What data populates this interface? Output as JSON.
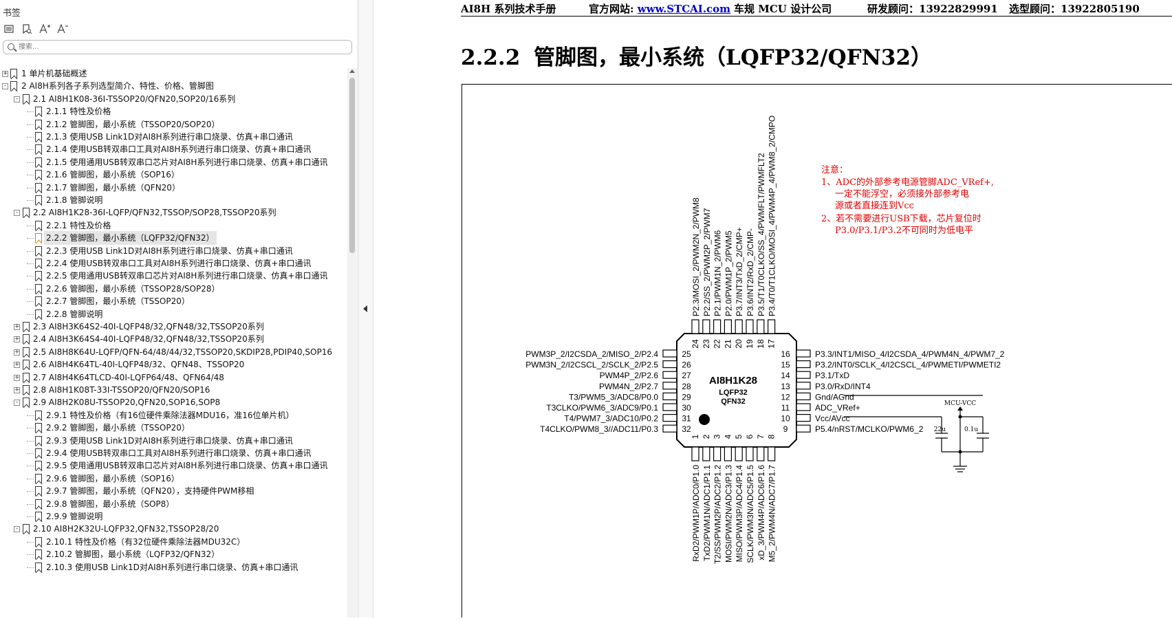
{
  "sidebar": {
    "title": "书签",
    "search_placeholder": "搜索...",
    "tools": [
      "list-icon",
      "bookmark-search-icon",
      "font-increase-icon",
      "font-decrease-icon"
    ],
    "items": [
      {
        "level": 0,
        "expander": "+",
        "label": "1 单片机基础概述"
      },
      {
        "level": 0,
        "expander": "-",
        "label": "2  AI8H系列各子系列选型简介、特性、价格、管脚图"
      },
      {
        "level": 1,
        "expander": "-",
        "label": "2.1 AI8H1K08-36I-TSSOP20/QFN20,SOP20/16系列"
      },
      {
        "level": 2,
        "expander": "",
        "label": "2.1.1 特性及价格"
      },
      {
        "level": 2,
        "expander": "",
        "label": "2.1.2  管脚图，最小系统（TSSOP20/SOP20）"
      },
      {
        "level": 2,
        "expander": "",
        "label": "2.1.3  使用USB Link1D对AI8H系列进行串口烧录、仿真+串口通讯"
      },
      {
        "level": 2,
        "expander": "",
        "label": "2.1.4 使用USB转双串口工具对AI8H系列进行串口烧录、仿真+串口通讯"
      },
      {
        "level": 2,
        "expander": "",
        "label": "2.1.5 使用通用USB转双串口芯片对AI8H系列进行串口烧录、仿真+串口通讯"
      },
      {
        "level": 2,
        "expander": "",
        "label": "2.1.6  管脚图，最小系统（SOP16）"
      },
      {
        "level": 2,
        "expander": "",
        "label": "2.1.7 管脚图，最小系统（QFN20）"
      },
      {
        "level": 2,
        "expander": "",
        "label": "2.1.8  管脚说明"
      },
      {
        "level": 1,
        "expander": "-",
        "label": "2.2  AI8H1K28-36I-LQFP/QFN32,TSSOP/SOP28,TSSOP20系列"
      },
      {
        "level": 2,
        "expander": "",
        "label": "2.2.1 特性及价格"
      },
      {
        "level": 2,
        "expander": "",
        "label": "2.2.2  管脚图，最小系统（LQFP32/QFN32）",
        "selected": true
      },
      {
        "level": 2,
        "expander": "",
        "label": "2.2.3  使用USB Link1D对AI8H系列进行串口烧录、仿真+串口通讯"
      },
      {
        "level": 2,
        "expander": "",
        "label": "2.2.4 使用USB转双串口工具对AI8H系列进行串口烧录、仿真+串口通讯"
      },
      {
        "level": 2,
        "expander": "",
        "label": "2.2.5 使用通用USB转双串口芯片对AI8H系列进行串口烧录、仿真+串口通讯"
      },
      {
        "level": 2,
        "expander": "",
        "label": "2.2.6  管脚图，最小系统（TSSOP28/SOP28）"
      },
      {
        "level": 2,
        "expander": "",
        "label": "2.2.7 管脚图，最小系统（TSSOP20）"
      },
      {
        "level": 2,
        "expander": "",
        "label": "2.2.8  管脚说明"
      },
      {
        "level": 1,
        "expander": "+",
        "label": "2.3  AI8H3K64S2-40I-LQFP48/32,QFN48/32,TSSOP20系列"
      },
      {
        "level": 1,
        "expander": "+",
        "label": "2.4  AI8H3K64S4-40I-LQFP48/32,QFN48/32,TSSOP20系列"
      },
      {
        "level": 1,
        "expander": "+",
        "label": "2.5  AI8H8K64U-LQFP/QFN-64/48/44/32,TSSOP20,SKDIP28,PDIP40,SOP16"
      },
      {
        "level": 1,
        "expander": "+",
        "label": "2.6  AI8H4K64TL-40I-LQFP48/32、QFN48、TSSOP20"
      },
      {
        "level": 1,
        "expander": "+",
        "label": "2.7  AI8H4K64TLCD-40I-LQFP64/48、QFN64/48"
      },
      {
        "level": 1,
        "expander": "+",
        "label": "2.8  AI8H1K08T-33I-TSSOP20/QFN20/SOP16"
      },
      {
        "level": 1,
        "expander": "-",
        "label": "2.9  AI8H2K08U-TSSOP20,QFN20,SOP16,SOP8"
      },
      {
        "level": 2,
        "expander": "",
        "label": "2.9.1 特性及价格（有16位硬件乘除法器MDU16，准16位单片机）"
      },
      {
        "level": 2,
        "expander": "",
        "label": "2.9.2  管脚图，最小系统（TSSOP20）"
      },
      {
        "level": 2,
        "expander": "",
        "label": "2.9.3  使用USB Link1D对AI8H系列进行串口烧录、仿真+串口通讯"
      },
      {
        "level": 2,
        "expander": "",
        "label": "2.9.4 使用USB转双串口工具对AI8H系列进行串口烧录、仿真+串口通讯"
      },
      {
        "level": 2,
        "expander": "",
        "label": "2.9.5 使用通用USB转双串口芯片对AI8H系列进行串口烧录、仿真+串口通讯"
      },
      {
        "level": 2,
        "expander": "",
        "label": "2.9.6  管脚图，最小系统（SOP16）"
      },
      {
        "level": 2,
        "expander": "",
        "label": "2.9.7  管脚图，最小系统（QFN20），支持硬件PWM移相"
      },
      {
        "level": 2,
        "expander": "",
        "label": "2.9.8  管脚图，最小系统（SOP8）"
      },
      {
        "level": 2,
        "expander": "",
        "label": "2.9.9  管脚说明"
      },
      {
        "level": 1,
        "expander": "-",
        "label": "2.10  AI8H2K32U-LQFP32,QFN32,TSSOP28/20"
      },
      {
        "level": 2,
        "expander": "",
        "label": "2.10.1 特性及价格（有32位硬件乘除法器MDU32C）"
      },
      {
        "level": 2,
        "expander": "",
        "label": "2.10.2  管脚图，最小系统（LQFP32/QFN32）"
      },
      {
        "level": 2,
        "expander": "",
        "label": "2.10.3  使用USB Link1D对AI8H系列进行串口烧录、仿真+串口通讯"
      }
    ]
  },
  "page": {
    "header": {
      "manual": "AI8H 系列技术手册",
      "website_label": "官方网站:",
      "website_link": "www.STCAI.com",
      "company": "车规 MCU 设计公司",
      "dev_consultant": "研发顾问：13922829991",
      "selection_consultant": "选型顾问：13922805190"
    },
    "heading_num": "2.2.2",
    "heading_text": "管脚图，最小系统（LQFP32/QFN32）"
  },
  "diagram": {
    "chip_name": "AI8H1K28",
    "package1": "LQFP32",
    "package2": "QFN32",
    "notes": [
      "注意：",
      "1、ADC的外部参考电源管脚ADC_VRef+,",
      "一定不能浮空，必须接外部参考电",
      "源或者直接连到Vcc",
      "2、若不需要进行USB下载，芯片复位时",
      "P3.0/P3.1/P3.2不可同时为低电平"
    ],
    "left_pins": [
      {
        "num": "25",
        "label": "PWM3P_2/I2CSDA_2/MISO_2/P2.4"
      },
      {
        "num": "26",
        "label": "PWM3N_2/I2CSCL_2/SCLK_2/P2.5"
      },
      {
        "num": "27",
        "label": "PWM4P_2/P2.6"
      },
      {
        "num": "28",
        "label": "PWM4N_2/P2.7"
      },
      {
        "num": "29",
        "label": "T3/PWM5_3/ADC8/P0.0"
      },
      {
        "num": "30",
        "label": "T3CLKO/PWM6_3/ADC9/P0.1"
      },
      {
        "num": "31",
        "label": "T4/PWM7_3/ADC10/P0.2"
      },
      {
        "num": "32",
        "label": "T4CLKO/PWM8_3//ADC11/P0.3"
      }
    ],
    "right_pins": [
      {
        "num": "16",
        "label": "P3.3/INT1/MISO_4/I2CSDA_4/PWM4N_4/PWM7_2"
      },
      {
        "num": "15",
        "label": "P3.2/INT0/SCLK_4/I2CSCL_4/PWMETI/PWMETI2"
      },
      {
        "num": "14",
        "label": "P3.1/TxD"
      },
      {
        "num": "13",
        "label": "P3.0/RxD/INT4"
      },
      {
        "num": "12",
        "label": "Gnd/AGnd"
      },
      {
        "num": "11",
        "label": "ADC_VRef+"
      },
      {
        "num": "10",
        "label": "Vcc/AVcc"
      },
      {
        "num": "9",
        "label": "P5.4/nRST/MCLKO/PWM6_2"
      }
    ],
    "top_pins": [
      {
        "num": "24",
        "label": "P2.3/MOSI_2/PWM2N_2/PWM8"
      },
      {
        "num": "23",
        "label": "P2.2/SS_2/PWM2P_2/PWM7"
      },
      {
        "num": "22",
        "label": "P2.1/PWM1N_2/PWM6"
      },
      {
        "num": "21",
        "label": "P2.0/PWM1P_2/PWM5"
      },
      {
        "num": "20",
        "label": "P3.7/INT3/TxD_2/CMP+"
      },
      {
        "num": "19",
        "label": "P3.6/INT2/RxD_2/CMP-"
      },
      {
        "num": "18",
        "label": "P3.5/T1/T0CLKO/SS_4/PWMFLT/PWMFLT2"
      },
      {
        "num": "17",
        "label": "P3.4/T0/T1CLKO/MOSI_4/PWM4P_4/PWM8_2/CMPO"
      }
    ],
    "bottom_pins": [
      {
        "num": "1",
        "label": "RxD2/PWM1P/ADC0/P1.0"
      },
      {
        "num": "2",
        "label": "TxD2/PWM1N/ADC1/P1.1"
      },
      {
        "num": "3",
        "label": "T2/SS/PWM2P/ADC2/P1.2"
      },
      {
        "num": "4",
        "label": "MOSI/PWM2N/ADC3/P1.3"
      },
      {
        "num": "5",
        "label": "MISO/PWM3P/ADC4/P1.4"
      },
      {
        "num": "6",
        "label": "SCLK/PWM3N/ADC5/P1.5"
      },
      {
        "num": "7",
        "label": "xD_3/PWM4P/ADC6/P1.6"
      },
      {
        "num": "8",
        "label": "M5_2/PWM4N/ADC7/P1.7"
      }
    ],
    "mcu_vcc": "MCU-VCC",
    "cap1": "22u",
    "cap2": "0.1u",
    "colors": {
      "note": "#e00000",
      "link": "#0000cc",
      "selected_bookmark": "#e08000"
    }
  }
}
